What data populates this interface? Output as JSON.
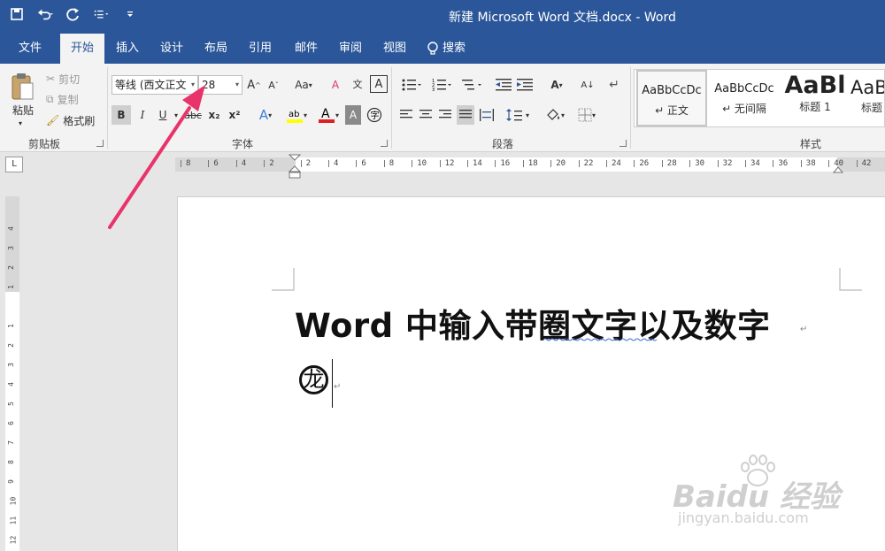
{
  "window": {
    "title": "新建 Microsoft Word 文档.docx  -  Word"
  },
  "qat": {
    "save_icon": "save-icon",
    "undo_icon": "undo-icon",
    "redo_icon": "redo-icon",
    "list_icon": "list-icon",
    "customize_icon": "customize-icon"
  },
  "tabs": [
    {
      "label": "文件"
    },
    {
      "label": "开始"
    },
    {
      "label": "插入"
    },
    {
      "label": "设计"
    },
    {
      "label": "布局"
    },
    {
      "label": "引用"
    },
    {
      "label": "邮件"
    },
    {
      "label": "审阅"
    },
    {
      "label": "视图"
    }
  ],
  "tell_me": {
    "label": "搜索",
    "icon": "lightbulb-icon"
  },
  "clipboard": {
    "label": "剪贴板",
    "paste": "粘贴",
    "cut": "剪切",
    "copy": "复制",
    "format_painter": "格式刷"
  },
  "font": {
    "label": "字体",
    "name": "等线 (西文正文",
    "size": "28",
    "bold": "B",
    "italic": "I",
    "underline": "U",
    "strike": "abc",
    "subscript": "x₂",
    "superscript": "x²",
    "grow": "A^",
    "shrink": "A˅",
    "change_case": "Aa",
    "font_color": "A",
    "char_shading": "A",
    "enclose": "字"
  },
  "paragraph": {
    "label": "段落"
  },
  "styles": {
    "label": "样式",
    "items": [
      {
        "sample": "AaBbCcDc",
        "name": "↵ 正文"
      },
      {
        "sample": "AaBbCcDc",
        "name": "↵ 无间隔"
      },
      {
        "sample": "AaBl",
        "name": "标题 1"
      },
      {
        "sample": "AaB",
        "name": "标题"
      }
    ]
  },
  "ruler": {
    "tab_selector": "L",
    "ticks": [
      "8",
      "6",
      "4",
      "2",
      "2",
      "4",
      "6",
      "8",
      "10",
      "12",
      "14",
      "16",
      "18",
      "20",
      "22",
      "24",
      "26",
      "28",
      "30",
      "32",
      "34",
      "36",
      "38",
      "40",
      "42"
    ],
    "vticks": [
      "4",
      "3",
      "2",
      "1",
      "1",
      "2",
      "3",
      "4",
      "5",
      "6",
      "7",
      "8",
      "9",
      "10",
      "11",
      "12"
    ]
  },
  "document": {
    "title": "Word 中输入带圈文字以及数字",
    "enclosed_char": "龙",
    "para_mark": "↵"
  },
  "watermark": {
    "brand": "Baidu 经验",
    "url": "jingyan.baidu.com"
  },
  "colors": {
    "title_bar": "#2b579a",
    "arrow": "#e8336b",
    "highlight_yellow": "#ffff00",
    "font_red": "#e02020"
  }
}
